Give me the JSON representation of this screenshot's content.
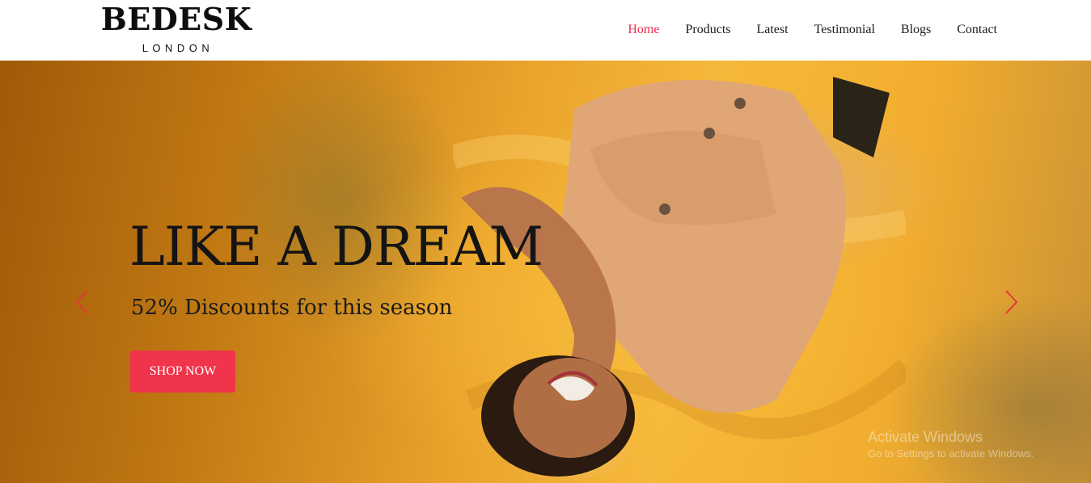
{
  "brand": {
    "name": "BEDESK",
    "tagline": "LONDON"
  },
  "nav": {
    "items": [
      {
        "label": "Home",
        "active": true
      },
      {
        "label": "Products",
        "active": false
      },
      {
        "label": "Latest",
        "active": false
      },
      {
        "label": "Testimonial",
        "active": false
      },
      {
        "label": "Blogs",
        "active": false
      },
      {
        "label": "Contact",
        "active": false
      }
    ]
  },
  "hero": {
    "heading": "LIKE A DREAM",
    "subtitle": "52% Discounts for this season",
    "cta_label": "SHOP NOW",
    "prev_icon": "chevron-left-icon",
    "next_icon": "chevron-right-icon"
  },
  "watermark": {
    "title": "Activate Windows",
    "subtitle": "Go to Settings to activate Windows."
  },
  "colors": {
    "accent": "#ea2e49",
    "button": "#f0344b",
    "text_dark": "#141414",
    "hero_orange": "#f6b83a"
  }
}
